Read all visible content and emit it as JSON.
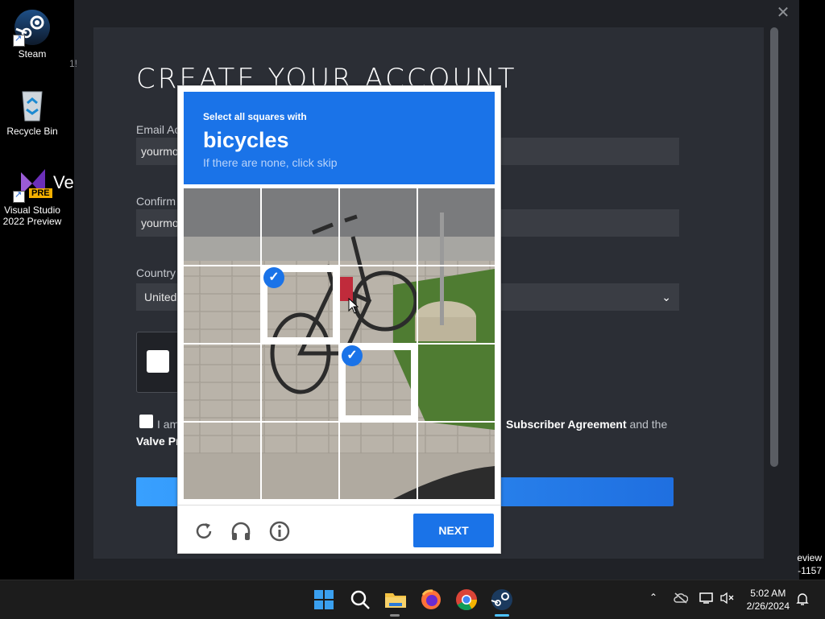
{
  "desktop": {
    "icons": [
      {
        "label": "Steam",
        "icon": "steam-icon"
      },
      {
        "label": "Recycle Bin",
        "icon": "recycle-bin-icon"
      },
      {
        "label": "Visual Studio 2022 Preview",
        "icon": "visual-studio-icon",
        "badge": "PRE"
      }
    ]
  },
  "steam": {
    "title": "CREATE YOUR ACCOUNT",
    "email_label": "Email Ac",
    "email_value": "yourmo",
    "confirm_label": "Confirm",
    "confirm_value": "yourmo",
    "country_label": "Country",
    "country_value": "United",
    "agree_prefix": "I am",
    "agree_link": "Subscriber Agreement",
    "agree_suffix": "and the",
    "agree_line2": "Valve Pr",
    "close_icon": "close-icon",
    "edge_text_1": "eview",
    "edge_text_2": "-1157",
    "edge_text_top": "1!"
  },
  "recaptcha": {
    "instruction": "Select all squares with",
    "target": "bicycles",
    "hint": "If there are none, click skip",
    "next_label": "NEXT",
    "selected_tiles": [
      "row2-col2",
      "row3-col3"
    ],
    "footer_icons": [
      "reload-icon",
      "audio-icon",
      "info-icon"
    ]
  },
  "taskbar": {
    "apps": [
      "start-icon",
      "search-icon",
      "file-explorer-icon",
      "firefox-icon",
      "chrome-icon",
      "steam-icon"
    ],
    "time": "5:02 AM",
    "date": "2/26/2024",
    "colors": {
      "accent": "#1a73e8",
      "taskbar": "#1c1c1c"
    }
  }
}
